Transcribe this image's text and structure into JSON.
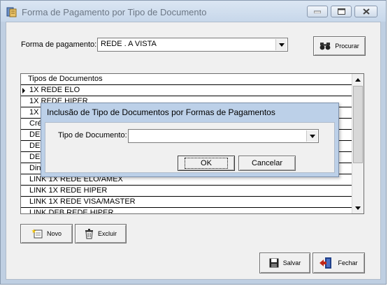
{
  "window": {
    "title": "Forma de Pagamento por Tipo de Documento"
  },
  "filter": {
    "label": "Forma de pagamento:",
    "value": "REDE . A VISTA",
    "search_button": "Procurar"
  },
  "grid": {
    "header": "Tipos de Documentos",
    "rows": [
      "1X REDE ELO",
      "1X REDE HIPER",
      "1X R",
      "Créd",
      "DEB",
      "DEB",
      "DEB",
      "Dinh",
      "LINK 1X REDE ELO/AMEX",
      "LINK 1X REDE HIPER",
      "LINK 1X REDE VISA/MASTER",
      "LINK DEB REDE HIPER"
    ],
    "selected_row": 0
  },
  "toolbar": {
    "new_label": "Novo",
    "delete_label": "Excluir",
    "save_label": "Salvar",
    "close_label": "Fechar"
  },
  "dialog": {
    "title": "Inclusão de Tipo de Documentos por  Formas de Pagamentos",
    "field_label": "Tipo de Documento:",
    "field_value": "",
    "ok_label": "OK",
    "cancel_label": "Cancelar"
  },
  "icons": {
    "app": "app-document-icon",
    "minimize": "minimize-icon",
    "maximize": "maximize-icon",
    "close": "close-icon",
    "search": "binoculars-icon",
    "new": "new-document-icon",
    "delete": "trash-icon",
    "save": "floppy-disk-icon",
    "exit": "exit-door-icon"
  },
  "colors": {
    "title_text": "#6c7785",
    "window_frame": "#bfcfe2",
    "dialog_frame": "#bcd0e8",
    "face": "#f0f0f0"
  }
}
